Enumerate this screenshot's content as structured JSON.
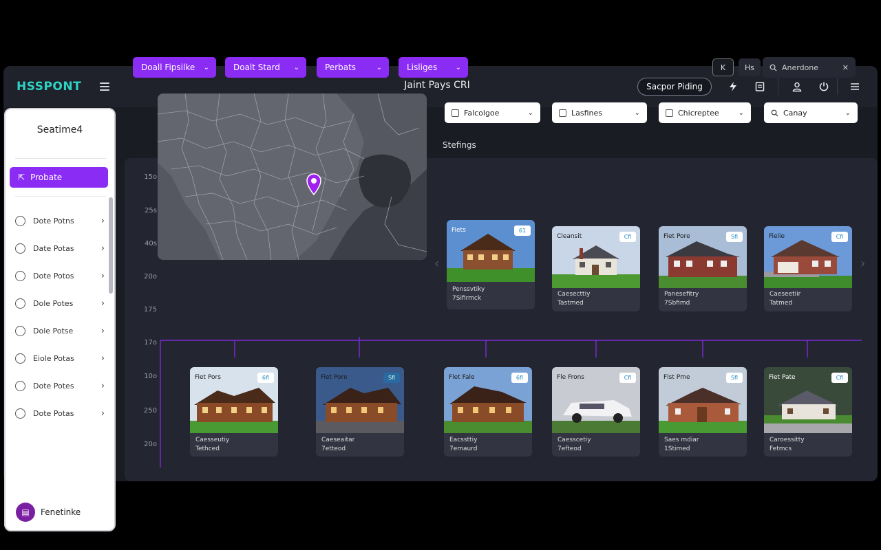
{
  "header": {
    "logo": "HSSPONT",
    "title": "Jaint Pays CRI",
    "support_label": "Sacpor Piding"
  },
  "sidebar": {
    "title": "Seatime4",
    "active_label": "Probate",
    "items": [
      {
        "label": "Dote Potns"
      },
      {
        "label": "Date Potas"
      },
      {
        "label": "Dote Potos"
      },
      {
        "label": "Dole Potes"
      },
      {
        "label": "Dole Potse"
      },
      {
        "label": "Eiole Potas"
      },
      {
        "label": "Dote Potes"
      },
      {
        "label": "Dote Potas"
      }
    ],
    "footer_label": "Fenetinke"
  },
  "filters": [
    {
      "label": "Doall Fipsilke"
    },
    {
      "label": "Doalt Stard"
    },
    {
      "label": "Perbats"
    },
    {
      "label": "Lisliges"
    }
  ],
  "controls": {
    "btn_k": "K",
    "btn_hs": "Hs",
    "search_value": "Anerdone"
  },
  "y_labels": [
    "15o",
    "25s",
    "40s",
    "20o",
    "175",
    "17o",
    "10o",
    "250",
    "20o"
  ],
  "dropdowns": [
    {
      "label": "Falcolgoe",
      "icon": "home-icon"
    },
    {
      "label": "Lasfines",
      "icon": "doc-icon"
    },
    {
      "label": "Chicreptee",
      "icon": "doc-icon"
    },
    {
      "label": "Canay",
      "icon": "search-icon"
    }
  ],
  "listings_label": "Stefings",
  "top_cards": [
    {
      "name": "Fiets",
      "badge": "61",
      "line1": "Penssvtiky",
      "line2": "7Sifirmck"
    },
    {
      "name": "Cleansit",
      "badge": "Cfl",
      "line1": "Caesecttiy",
      "line2": "Tastmed"
    },
    {
      "name": "Fiet Pore",
      "badge": "Sfl",
      "line1": "Panesefitry",
      "line2": "7Sbfimd"
    },
    {
      "name": "Fielie",
      "badge": "Cfl",
      "line1": "Caeseetiir",
      "line2": "Tatmed"
    }
  ],
  "bottom_cards": [
    {
      "name": "Fiet Pors",
      "badge": "6fl",
      "line1": "Caesseutiy",
      "line2": "Tethced"
    },
    {
      "name": "Fiet Pore",
      "badge": "Sfl",
      "line1": "Caeseaitar",
      "line2": "7etteod"
    },
    {
      "name": "Flet Fale",
      "badge": "6fl",
      "line1": "Eacssttiy",
      "line2": "7emaurd"
    },
    {
      "name": "Fle Frons",
      "badge": "Cfl",
      "line1": "Caesscetiy",
      "line2": "7efteod"
    },
    {
      "name": "Flst Pme",
      "badge": "Sfl",
      "line1": "Saes mdiar",
      "line2": "1Stimed"
    },
    {
      "name": "Fiet Pate",
      "badge": "Cfl",
      "line1": "Caroessitty",
      "line2": "Fetmcs"
    }
  ]
}
